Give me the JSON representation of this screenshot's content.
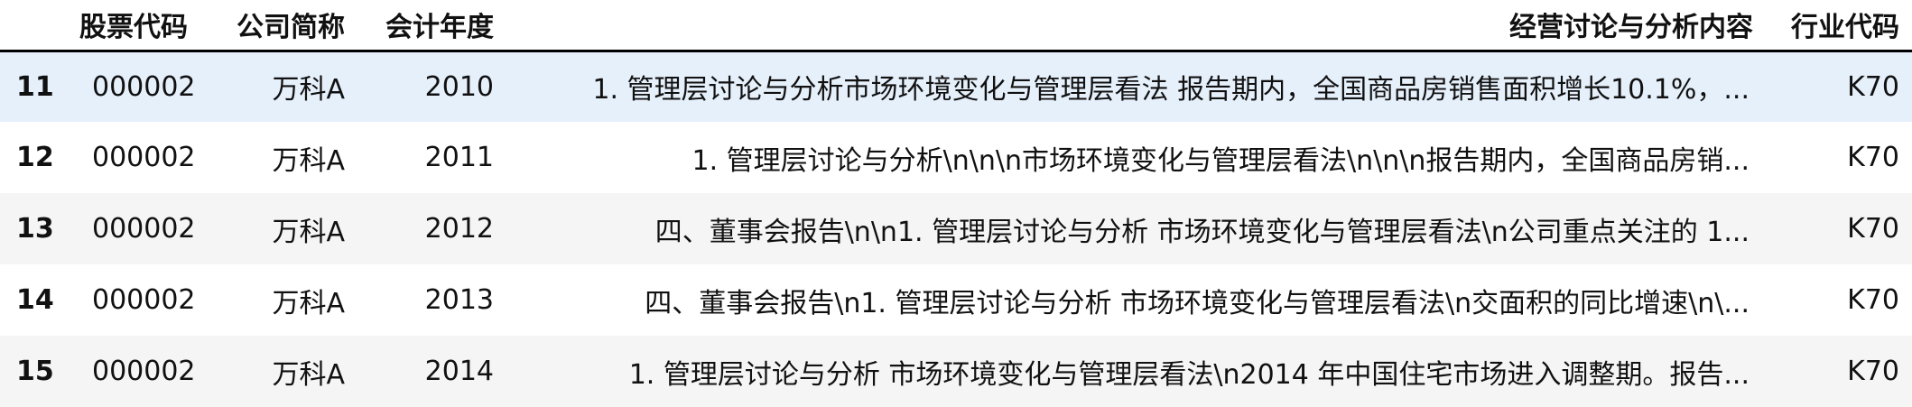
{
  "table": {
    "columns": [
      {
        "key": "index",
        "label": ""
      },
      {
        "key": "stock_code",
        "label": "股票代码"
      },
      {
        "key": "company",
        "label": "公司简称"
      },
      {
        "key": "year",
        "label": "会计年度"
      },
      {
        "key": "content",
        "label": "经营讨论与分析内容"
      },
      {
        "key": "industry",
        "label": "行业代码"
      }
    ],
    "rows": [
      {
        "index": "11",
        "stock_code": "000002",
        "company": "万科A",
        "year": "2010",
        "content": "1. 管理层讨论与分析市场环境变化与管理层看法 报告期内，全国商品房销售面积增长10.1%，...",
        "industry": "K70"
      },
      {
        "index": "12",
        "stock_code": "000002",
        "company": "万科A",
        "year": "2011",
        "content": "1. 管理层讨论与分析\\n\\n\\n市场环境变化与管理层看法\\n\\n\\n报告期内，全国商品房销...",
        "industry": "K70"
      },
      {
        "index": "13",
        "stock_code": "000002",
        "company": "万科A",
        "year": "2012",
        "content": "四、董事会报告\\n\\n1. 管理层讨论与分析 市场环境变化与管理层看法\\n公司重点关注的 1...",
        "industry": "K70"
      },
      {
        "index": "14",
        "stock_code": "000002",
        "company": "万科A",
        "year": "2013",
        "content": "四、董事会报告\\n1. 管理层讨论与分析 市场环境变化与管理层看法\\n交面积的同比增速\\n\\...",
        "industry": "K70"
      },
      {
        "index": "15",
        "stock_code": "000002",
        "company": "万科A",
        "year": "2014",
        "content": "1. 管理层讨论与分析 市场环境变化与管理层看法\\n2014 年中国住宅市场进入调整期。报告...",
        "industry": "K70"
      }
    ]
  },
  "colors": {
    "hover_row": "#e6f0fb",
    "striped_row": "#f5f5f5",
    "header_rule": "#000000"
  }
}
